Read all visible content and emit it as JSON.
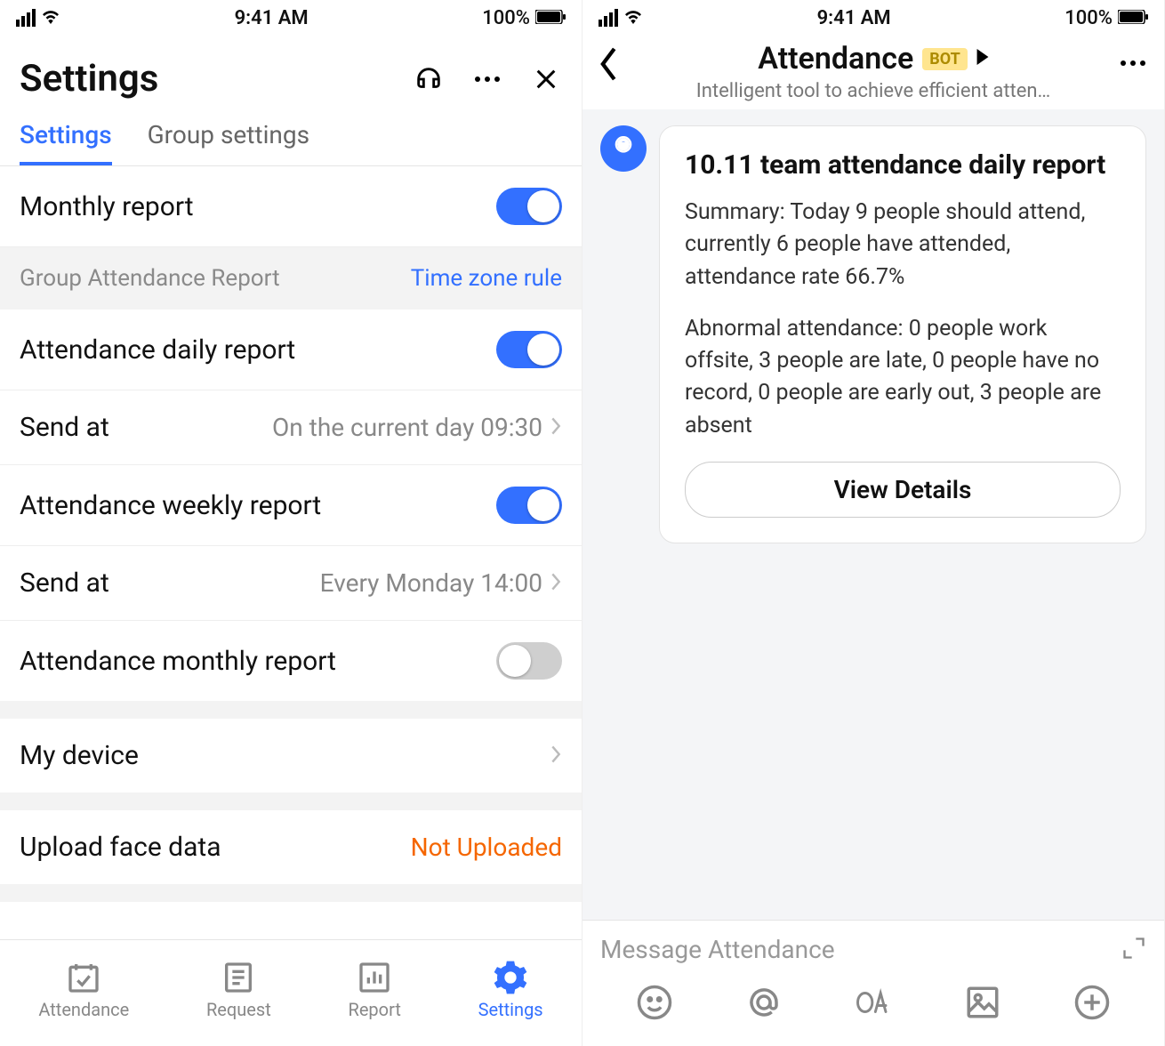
{
  "status": {
    "time": "9:41 AM",
    "battery": "100%"
  },
  "left": {
    "header_title": "Settings",
    "tabs": {
      "settings": "Settings",
      "group": "Group settings"
    },
    "rows": {
      "monthly_report": "Monthly report",
      "group_header": "Group Attendance Report",
      "tz_link": "Time zone rule",
      "daily_report": "Attendance daily report",
      "daily_send_at_label": "Send at",
      "daily_send_at_value": "On the current day 09:30",
      "weekly_report": "Attendance weekly report",
      "weekly_send_at_label": "Send at",
      "weekly_send_at_value": "Every Monday 14:00",
      "att_monthly_report": "Attendance monthly report",
      "my_device": "My device",
      "upload_face": "Upload face data",
      "upload_value": "Not Uploaded"
    },
    "toggles": {
      "monthly": true,
      "daily": true,
      "weekly": true,
      "att_monthly": false
    },
    "nav": {
      "attendance": "Attendance",
      "request": "Request",
      "report": "Report",
      "settings": "Settings"
    }
  },
  "right": {
    "title": "Attendance",
    "badge": "BOT",
    "subtitle": "Intelligent tool to achieve efficient atten…",
    "card": {
      "title": "10.11 team attendance daily report",
      "p1": "Summary: Today 9 people should attend, currently 6 people have attended, attendance rate 66.7%",
      "p2": "Abnormal attendance: 0 people work offsite, 3 people are late, 0 people have no record, 0 people are early out, 3 people are absent",
      "button": "View Details"
    },
    "input_placeholder": "Message Attendance"
  }
}
